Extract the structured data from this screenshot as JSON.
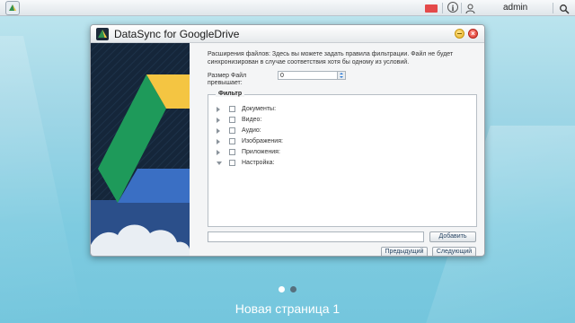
{
  "taskbar": {
    "username": "admin"
  },
  "window": {
    "title": "DataSync for GoogleDrive",
    "description": "Расширения файлов: Здесь вы можете задать правила фильтрации. Файл не будет синхронизирован в случае соответствия хотя бы одному из условий.",
    "size_label": "Размер Файл превышает:",
    "size_value": "0",
    "filter": {
      "legend": "Фильтр",
      "items": [
        {
          "label": "Документы:",
          "expanded": false
        },
        {
          "label": "Видео:",
          "expanded": false
        },
        {
          "label": "Аудио:",
          "expanded": false
        },
        {
          "label": "Изображения:",
          "expanded": false
        },
        {
          "label": "Приложения:",
          "expanded": false
        },
        {
          "label": "Настройка:",
          "expanded": true
        }
      ]
    },
    "add_button": "Добавить",
    "prev_button": "Предыдущий",
    "next_button": "Следующий"
  },
  "desktop": {
    "page_label": "Новая страница 1",
    "current_page": 1,
    "total_pages": 2
  },
  "colors": {
    "drive_green": "#1e9a5a",
    "drive_yellow": "#f4c542",
    "banner_dark": "#15263a",
    "banner_blue": "#2b4f8a"
  }
}
